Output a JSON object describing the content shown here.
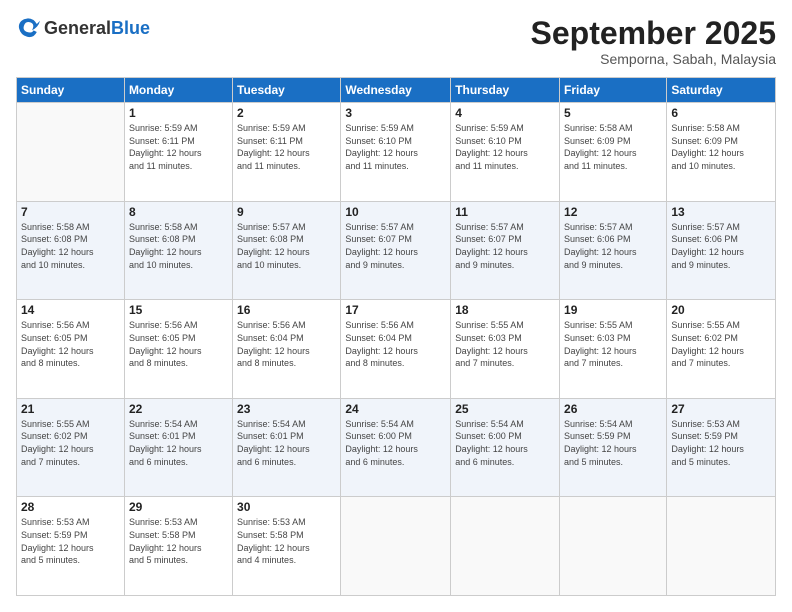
{
  "header": {
    "logo_general": "General",
    "logo_blue": "Blue",
    "month": "September 2025",
    "location": "Semporna, Sabah, Malaysia"
  },
  "weekdays": [
    "Sunday",
    "Monday",
    "Tuesday",
    "Wednesday",
    "Thursday",
    "Friday",
    "Saturday"
  ],
  "weeks": [
    [
      {
        "day": "",
        "info": ""
      },
      {
        "day": "1",
        "info": "Sunrise: 5:59 AM\nSunset: 6:11 PM\nDaylight: 12 hours\nand 11 minutes."
      },
      {
        "day": "2",
        "info": "Sunrise: 5:59 AM\nSunset: 6:11 PM\nDaylight: 12 hours\nand 11 minutes."
      },
      {
        "day": "3",
        "info": "Sunrise: 5:59 AM\nSunset: 6:10 PM\nDaylight: 12 hours\nand 11 minutes."
      },
      {
        "day": "4",
        "info": "Sunrise: 5:59 AM\nSunset: 6:10 PM\nDaylight: 12 hours\nand 11 minutes."
      },
      {
        "day": "5",
        "info": "Sunrise: 5:58 AM\nSunset: 6:09 PM\nDaylight: 12 hours\nand 11 minutes."
      },
      {
        "day": "6",
        "info": "Sunrise: 5:58 AM\nSunset: 6:09 PM\nDaylight: 12 hours\nand 10 minutes."
      }
    ],
    [
      {
        "day": "7",
        "info": "Sunrise: 5:58 AM\nSunset: 6:08 PM\nDaylight: 12 hours\nand 10 minutes."
      },
      {
        "day": "8",
        "info": "Sunrise: 5:58 AM\nSunset: 6:08 PM\nDaylight: 12 hours\nand 10 minutes."
      },
      {
        "day": "9",
        "info": "Sunrise: 5:57 AM\nSunset: 6:08 PM\nDaylight: 12 hours\nand 10 minutes."
      },
      {
        "day": "10",
        "info": "Sunrise: 5:57 AM\nSunset: 6:07 PM\nDaylight: 12 hours\nand 9 minutes."
      },
      {
        "day": "11",
        "info": "Sunrise: 5:57 AM\nSunset: 6:07 PM\nDaylight: 12 hours\nand 9 minutes."
      },
      {
        "day": "12",
        "info": "Sunrise: 5:57 AM\nSunset: 6:06 PM\nDaylight: 12 hours\nand 9 minutes."
      },
      {
        "day": "13",
        "info": "Sunrise: 5:57 AM\nSunset: 6:06 PM\nDaylight: 12 hours\nand 9 minutes."
      }
    ],
    [
      {
        "day": "14",
        "info": "Sunrise: 5:56 AM\nSunset: 6:05 PM\nDaylight: 12 hours\nand 8 minutes."
      },
      {
        "day": "15",
        "info": "Sunrise: 5:56 AM\nSunset: 6:05 PM\nDaylight: 12 hours\nand 8 minutes."
      },
      {
        "day": "16",
        "info": "Sunrise: 5:56 AM\nSunset: 6:04 PM\nDaylight: 12 hours\nand 8 minutes."
      },
      {
        "day": "17",
        "info": "Sunrise: 5:56 AM\nSunset: 6:04 PM\nDaylight: 12 hours\nand 8 minutes."
      },
      {
        "day": "18",
        "info": "Sunrise: 5:55 AM\nSunset: 6:03 PM\nDaylight: 12 hours\nand 7 minutes."
      },
      {
        "day": "19",
        "info": "Sunrise: 5:55 AM\nSunset: 6:03 PM\nDaylight: 12 hours\nand 7 minutes."
      },
      {
        "day": "20",
        "info": "Sunrise: 5:55 AM\nSunset: 6:02 PM\nDaylight: 12 hours\nand 7 minutes."
      }
    ],
    [
      {
        "day": "21",
        "info": "Sunrise: 5:55 AM\nSunset: 6:02 PM\nDaylight: 12 hours\nand 7 minutes."
      },
      {
        "day": "22",
        "info": "Sunrise: 5:54 AM\nSunset: 6:01 PM\nDaylight: 12 hours\nand 6 minutes."
      },
      {
        "day": "23",
        "info": "Sunrise: 5:54 AM\nSunset: 6:01 PM\nDaylight: 12 hours\nand 6 minutes."
      },
      {
        "day": "24",
        "info": "Sunrise: 5:54 AM\nSunset: 6:00 PM\nDaylight: 12 hours\nand 6 minutes."
      },
      {
        "day": "25",
        "info": "Sunrise: 5:54 AM\nSunset: 6:00 PM\nDaylight: 12 hours\nand 6 minutes."
      },
      {
        "day": "26",
        "info": "Sunrise: 5:54 AM\nSunset: 5:59 PM\nDaylight: 12 hours\nand 5 minutes."
      },
      {
        "day": "27",
        "info": "Sunrise: 5:53 AM\nSunset: 5:59 PM\nDaylight: 12 hours\nand 5 minutes."
      }
    ],
    [
      {
        "day": "28",
        "info": "Sunrise: 5:53 AM\nSunset: 5:59 PM\nDaylight: 12 hours\nand 5 minutes."
      },
      {
        "day": "29",
        "info": "Sunrise: 5:53 AM\nSunset: 5:58 PM\nDaylight: 12 hours\nand 5 minutes."
      },
      {
        "day": "30",
        "info": "Sunrise: 5:53 AM\nSunset: 5:58 PM\nDaylight: 12 hours\nand 4 minutes."
      },
      {
        "day": "",
        "info": ""
      },
      {
        "day": "",
        "info": ""
      },
      {
        "day": "",
        "info": ""
      },
      {
        "day": "",
        "info": ""
      }
    ]
  ]
}
